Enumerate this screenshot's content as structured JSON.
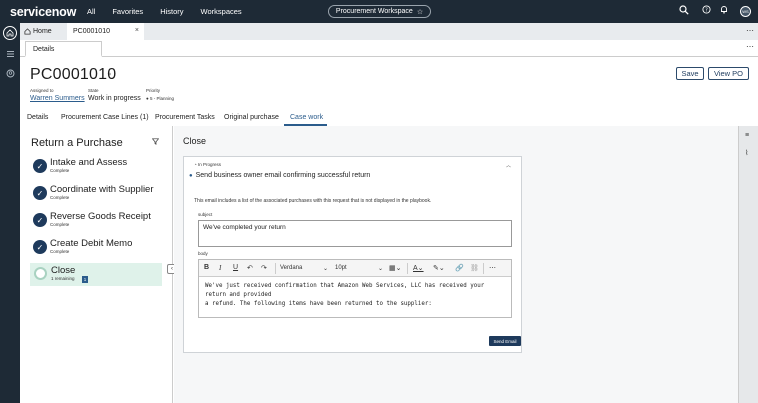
{
  "nav": {
    "logo": "servicenow",
    "items": [
      "All",
      "Favorites",
      "History",
      "Workspaces"
    ],
    "workspace_pill": "Procurement Workspace",
    "avatar_initials": "WS"
  },
  "tabs": {
    "home": "Home",
    "case": "PC0001010",
    "details": "Details"
  },
  "header": {
    "case_number": "PC0001010",
    "assigned_label": "Assigned to",
    "assigned_value": "Warren Summers",
    "state_label": "State",
    "state_value": "Work in progress",
    "priority_label": "Priority",
    "priority_value": "5 - Planning",
    "save_label": "Save",
    "view_po_label": "View PO"
  },
  "case_tabs": [
    "Details",
    "Procurement Case Lines (1)",
    "Procurement Tasks",
    "Original purchase",
    "Case work"
  ],
  "playbook": {
    "title": "Return a Purchase",
    "steps": [
      {
        "title": "Intake and Assess",
        "status": "Complete"
      },
      {
        "title": "Coordinate with Supplier",
        "status": "Complete"
      },
      {
        "title": "Reverse Goods Receipt",
        "status": "Complete"
      },
      {
        "title": "Create Debit Memo",
        "status": "Complete"
      }
    ],
    "active_step": {
      "title": "Close",
      "remaining": "1 remaining",
      "badge": "1"
    }
  },
  "main": {
    "heading": "Close",
    "card": {
      "status": "In Progress",
      "task": "Send business owner email confirming successful return",
      "description": "This email includes a list of the associated purchases with this request that is not displayed in the playbook.",
      "subject_label": "subject",
      "subject_value": "We've completed your return",
      "body_label": "body",
      "font": "Verdana",
      "font_size": "10pt",
      "body_line1": "We've just received confirmation that Amazon Web Services, LLC has received your return and provided",
      "body_line2": "a refund.  The following items have been returned to the supplier:",
      "send_label": "Send Email"
    }
  },
  "colors": {
    "topbar": "#1e2a36",
    "accent": "#2b5c8c",
    "active_step_bg": "#dff2ea",
    "check_bg": "#1e3a5c"
  }
}
